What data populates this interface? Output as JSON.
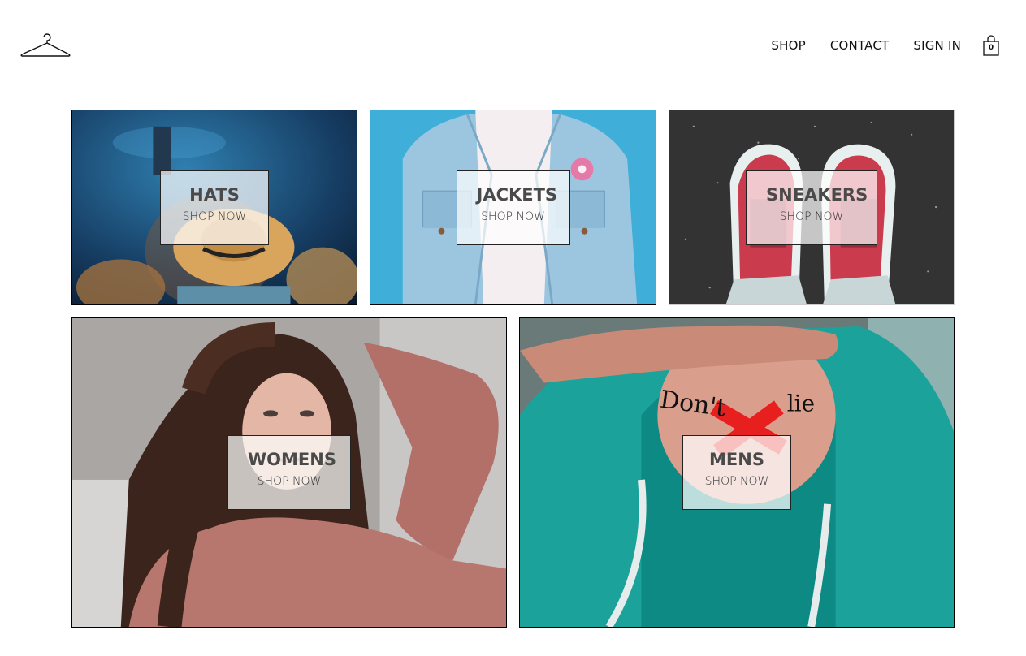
{
  "header": {
    "nav": [
      "SHOP",
      "CONTACT",
      "SIGN IN"
    ],
    "cart_count": "0",
    "logo_icon": "hanger-icon",
    "cart_icon": "shopping-bag-icon"
  },
  "categories": [
    {
      "title": "HATS",
      "cta": "SHOP NOW"
    },
    {
      "title": "JACKETS",
      "cta": "SHOP NOW"
    },
    {
      "title": "SNEAKERS",
      "cta": "SHOP NOW"
    },
    {
      "title": "WOMENS",
      "cta": "SHOP NOW"
    },
    {
      "title": "MENS",
      "cta": "SHOP NOW"
    }
  ],
  "colors": {
    "overlay": "#ffffffb8",
    "text_dark": "#4a4a4a",
    "nav_text": "#111111"
  }
}
